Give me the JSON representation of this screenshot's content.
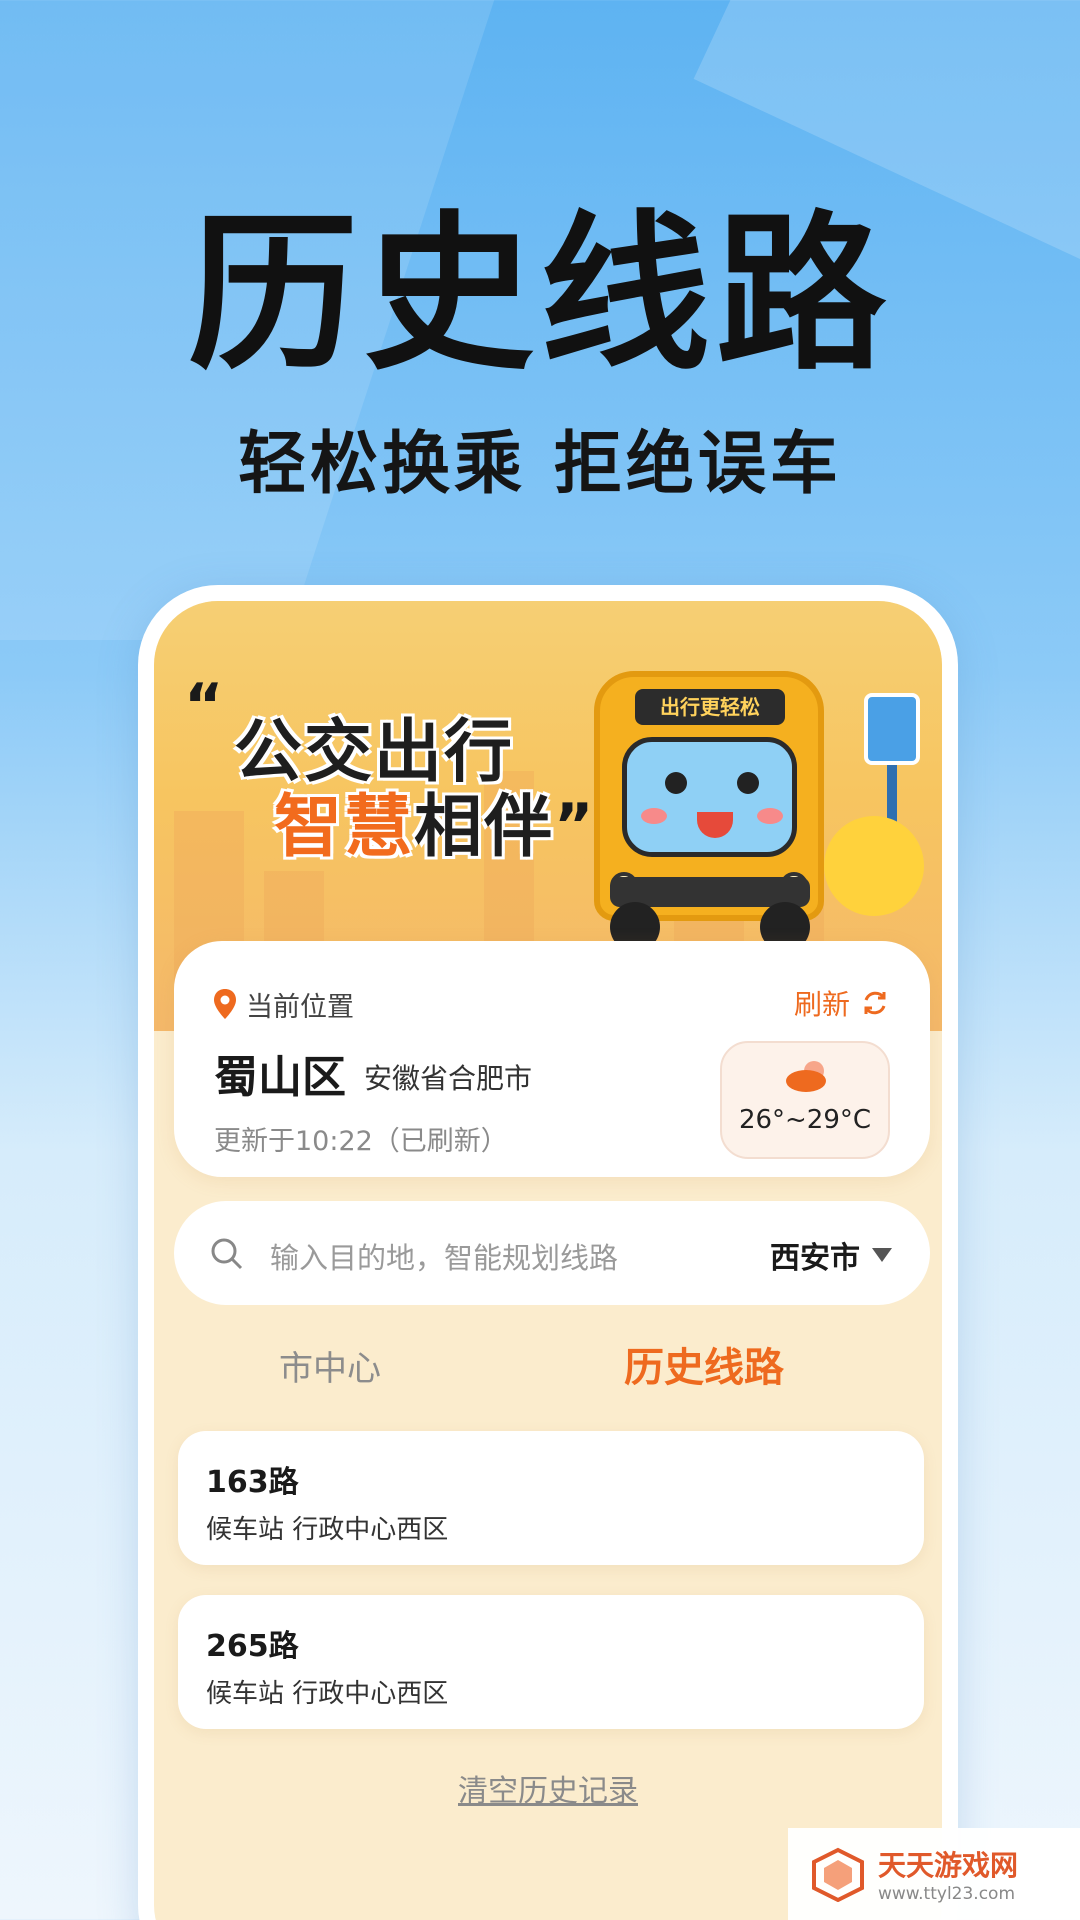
{
  "hero": {
    "title": "历史线路",
    "subtitle": "轻松换乘 拒绝误车"
  },
  "banner": {
    "quote_open": "“",
    "line1": "公交出行",
    "line2_highlight": "智慧",
    "line2_normal": "相伴",
    "quote_close": "”",
    "bus_sign": "出行更轻松"
  },
  "location": {
    "label": "当前位置",
    "refresh_label": "刷新",
    "district": "蜀山区",
    "province": "安徽省合肥市",
    "updated": "更新于10:22（已刷新）",
    "weather_temp": "26°~29°C"
  },
  "search": {
    "placeholder": "输入目的地，智能规划线路",
    "city": "西安市"
  },
  "tabs": [
    {
      "label": "市中心",
      "active": false
    },
    {
      "label": "历史线路",
      "active": true
    }
  ],
  "routes": [
    {
      "name": "163路",
      "stop": "候车站 行政中心西区"
    },
    {
      "name": "265路",
      "stop": "候车站 行政中心西区"
    }
  ],
  "clear_label": "清空历史记录",
  "watermark": {
    "title": "天天游戏网",
    "url": "www.ttyl23.com"
  },
  "colors": {
    "accent": "#ee6a1f",
    "sky": "#5eb3f2",
    "panel": "#fbeccd"
  }
}
